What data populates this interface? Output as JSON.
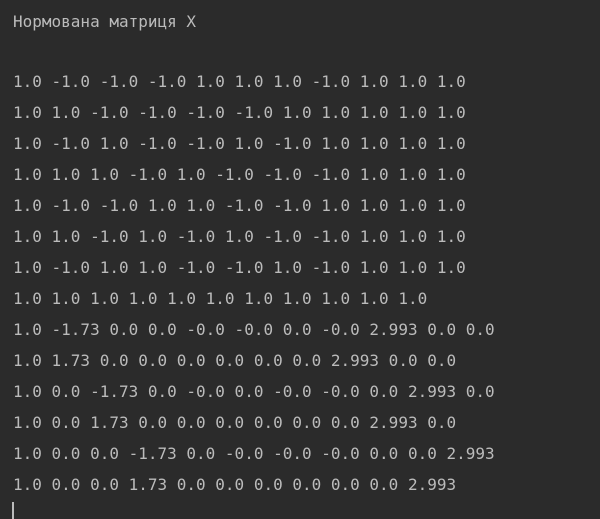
{
  "console": {
    "header": "Нормована матриця X",
    "rows": [
      "1.0 -1.0 -1.0 -1.0 1.0 1.0 1.0 -1.0 1.0 1.0 1.0",
      "1.0 1.0 -1.0 -1.0 -1.0 -1.0 1.0 1.0 1.0 1.0 1.0",
      "1.0 -1.0 1.0 -1.0 -1.0 1.0 -1.0 1.0 1.0 1.0 1.0",
      "1.0 1.0 1.0 -1.0 1.0 -1.0 -1.0 -1.0 1.0 1.0 1.0",
      "1.0 -1.0 -1.0 1.0 1.0 -1.0 -1.0 1.0 1.0 1.0 1.0",
      "1.0 1.0 -1.0 1.0 -1.0 1.0 -1.0 -1.0 1.0 1.0 1.0",
      "1.0 -1.0 1.0 1.0 -1.0 -1.0 1.0 -1.0 1.0 1.0 1.0",
      "1.0 1.0 1.0 1.0 1.0 1.0 1.0 1.0 1.0 1.0 1.0",
      "1.0 -1.73 0.0 0.0 -0.0 -0.0 0.0 -0.0 2.993 0.0 0.0",
      "1.0 1.73 0.0 0.0 0.0 0.0 0.0 0.0 2.993 0.0 0.0",
      "1.0 0.0 -1.73 0.0 -0.0 0.0 -0.0 -0.0 0.0 2.993 0.0",
      "1.0 0.0 1.73 0.0 0.0 0.0 0.0 0.0 0.0 2.993 0.0",
      "1.0 0.0 0.0 -1.73 0.0 -0.0 -0.0 -0.0 0.0 0.0 2.993",
      "1.0 0.0 0.0 1.73 0.0 0.0 0.0 0.0 0.0 0.0 2.993"
    ]
  }
}
